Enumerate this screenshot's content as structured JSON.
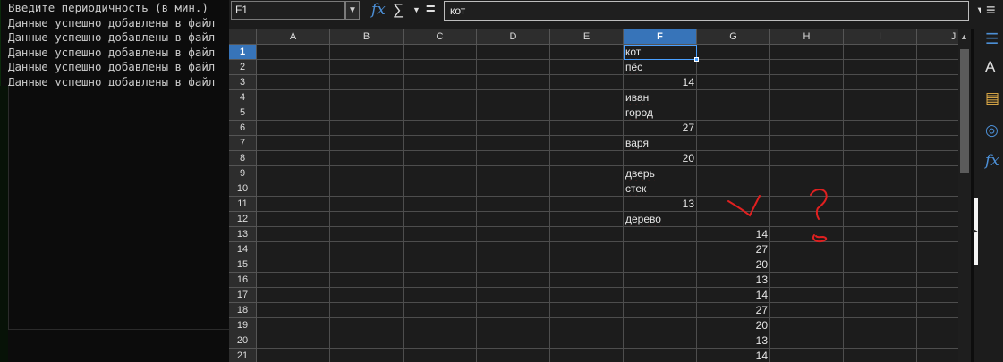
{
  "console": {
    "lines": [
      "Введите периодичность (в мин.)",
      "Данные успешно добавлены в файл",
      "Данные успешно добавлены в файл",
      "Данные успешно добавлены в файл",
      "Данные успешно добавлены в файл",
      "Данные успешно добавлены в файл"
    ]
  },
  "formula_bar": {
    "cell_ref": "F1",
    "fx": "fx",
    "sum": "∑",
    "equals": "=",
    "content": "кот"
  },
  "grid": {
    "columns": [
      "A",
      "B",
      "C",
      "D",
      "E",
      "F",
      "G",
      "H",
      "I",
      "J"
    ],
    "selected_column": "F",
    "rows": [
      {
        "n": "1",
        "F": "кот"
      },
      {
        "n": "2",
        "F": "пёс"
      },
      {
        "n": "3",
        "F": "14"
      },
      {
        "n": "4",
        "F": "иван"
      },
      {
        "n": "5",
        "F": "город"
      },
      {
        "n": "6",
        "F": "27"
      },
      {
        "n": "7",
        "F": "варя"
      },
      {
        "n": "8",
        "F": "20"
      },
      {
        "n": "9",
        "F": "дверь"
      },
      {
        "n": "10",
        "F": "стек"
      },
      {
        "n": "11",
        "F": "13"
      },
      {
        "n": "12",
        "F": "дерево"
      },
      {
        "n": "13",
        "G": "14"
      },
      {
        "n": "14",
        "G": "27"
      },
      {
        "n": "15",
        "G": "20"
      },
      {
        "n": "16",
        "G": "13"
      },
      {
        "n": "17",
        "G": "14"
      },
      {
        "n": "18",
        "G": "27"
      },
      {
        "n": "19",
        "G": "20"
      },
      {
        "n": "20",
        "G": "13"
      },
      {
        "n": "21",
        "G": "14"
      }
    ]
  },
  "colors": {
    "selection": "#3774b9",
    "annotation": "#e02020",
    "accent_icon": "#4c8fd6"
  },
  "sidebar": {
    "icons": [
      "menu-icon",
      "properties-icon",
      "styles-icon",
      "gallery-icon",
      "navigator-icon",
      "functions-icon"
    ]
  }
}
